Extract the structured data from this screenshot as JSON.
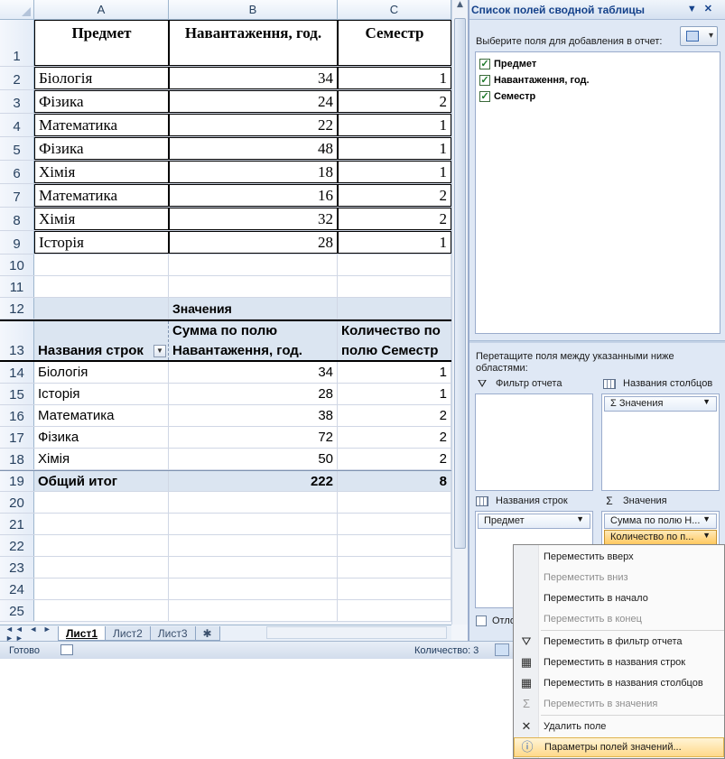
{
  "columns": [
    "A",
    "B",
    "C"
  ],
  "rows": [
    {
      "n": "1",
      "a": "Предмет",
      "b": "Навантаження, год.",
      "c": "Семестр"
    },
    {
      "n": "2",
      "a": "Біологія",
      "b": "34",
      "c": "1"
    },
    {
      "n": "3",
      "a": "Фізика",
      "b": "24",
      "c": "2"
    },
    {
      "n": "4",
      "a": "Математика",
      "b": "22",
      "c": "1"
    },
    {
      "n": "5",
      "a": "Фізика",
      "b": "48",
      "c": "1"
    },
    {
      "n": "6",
      "a": "Хімія",
      "b": "18",
      "c": "1"
    },
    {
      "n": "7",
      "a": "Математика",
      "b": "16",
      "c": "2"
    },
    {
      "n": "8",
      "a": "Хімія",
      "b": "32",
      "c": "2"
    },
    {
      "n": "9",
      "a": "Історія",
      "b": "28",
      "c": "1"
    },
    {
      "n": "10",
      "a": "",
      "b": "",
      "c": ""
    },
    {
      "n": "11",
      "a": "",
      "b": "",
      "c": ""
    }
  ],
  "pivot": {
    "values_caption_row": "12",
    "values_caption": "Значения",
    "header_row": "13",
    "row_labels": "Названия строк",
    "sum_header_line1": "Сумма по полю",
    "sum_header_line2": "Навантаження, год.",
    "count_header_line1": "Количество по",
    "count_header_line2": "полю Семестр",
    "items": [
      {
        "n": "14",
        "name": "Біологія",
        "sum": "34",
        "count": "1"
      },
      {
        "n": "15",
        "name": "Історія",
        "sum": "28",
        "count": "1"
      },
      {
        "n": "16",
        "name": "Математика",
        "sum": "38",
        "count": "2"
      },
      {
        "n": "17",
        "name": "Фізика",
        "sum": "72",
        "count": "2"
      },
      {
        "n": "18",
        "name": "Хімія",
        "sum": "50",
        "count": "2"
      }
    ],
    "total_row": "19",
    "total_label": "Общий итог",
    "total_sum": "222",
    "total_count": "8"
  },
  "empty_rows": [
    "20",
    "21",
    "22",
    "23",
    "24",
    "25"
  ],
  "sheet_tabs": [
    "Лист1",
    "Лист2",
    "Лист3"
  ],
  "status": {
    "ready": "Готово",
    "count": "Количество: 3"
  },
  "field_list": {
    "title": "Список полей сводной таблицы",
    "choose_label": "Выберите поля для добавления в отчет:",
    "fields": [
      "Предмет",
      "Навантаження, год.",
      "Семестр"
    ],
    "drag_hint": "Перетащите поля между указанными ниже областями:",
    "report_filter": "Фильтр отчета",
    "column_labels": "Названия столбцов",
    "column_chip": "Значения",
    "row_labels": "Названия строк",
    "row_chip": "Предмет",
    "values": "Значения",
    "value_chip_1": "Сумма по полю Н...",
    "value_chip_2": "Количество по п...",
    "defer_label": "Отло"
  },
  "context_menu": {
    "move_up": "Переместить вверх",
    "move_down": "Переместить вниз",
    "move_begin": "Переместить в начало",
    "move_end": "Переместить в конец",
    "to_filter": "Переместить в фильтр отчета",
    "to_rows": "Переместить в названия строк",
    "to_columns": "Переместить в названия столбцов",
    "to_values": "Переместить в значения",
    "remove": "Удалить поле",
    "settings": "Параметры полей значений..."
  }
}
